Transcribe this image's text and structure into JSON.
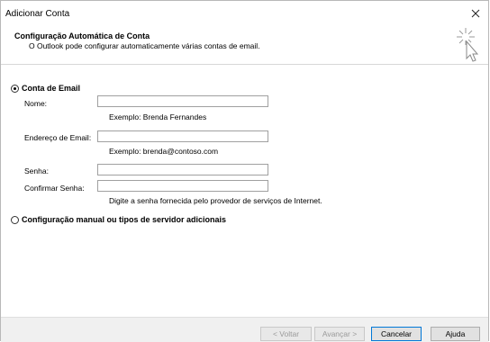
{
  "window": {
    "title": "Adicionar Conta"
  },
  "header": {
    "title": "Configuração Automática de Conta",
    "subtitle": "O Outlook pode configurar automaticamente várias contas de email."
  },
  "email_account": {
    "radio_label": "Conta de Email",
    "selected": true,
    "name": {
      "label": "Nome:",
      "value": "",
      "hint": "Exemplo: Brenda Fernandes"
    },
    "email": {
      "label": "Endereço de Email:",
      "value": "",
      "hint": "Exemplo: brenda@contoso.com"
    },
    "password": {
      "label": "Senha:",
      "value": ""
    },
    "confirm_password": {
      "label": "Confirmar Senha:",
      "value": "",
      "hint": "Digite a senha fornecida pelo provedor de serviços de Internet."
    }
  },
  "manual_setup": {
    "radio_label": "Configuração manual ou tipos de servidor adicionais",
    "selected": false
  },
  "buttons": {
    "back": "< Voltar",
    "next": "Avançar >",
    "cancel": "Cancelar",
    "help": "Ajuda"
  },
  "icons": {
    "close": "close-icon",
    "wizard": "cursor-sparkle-icon"
  }
}
